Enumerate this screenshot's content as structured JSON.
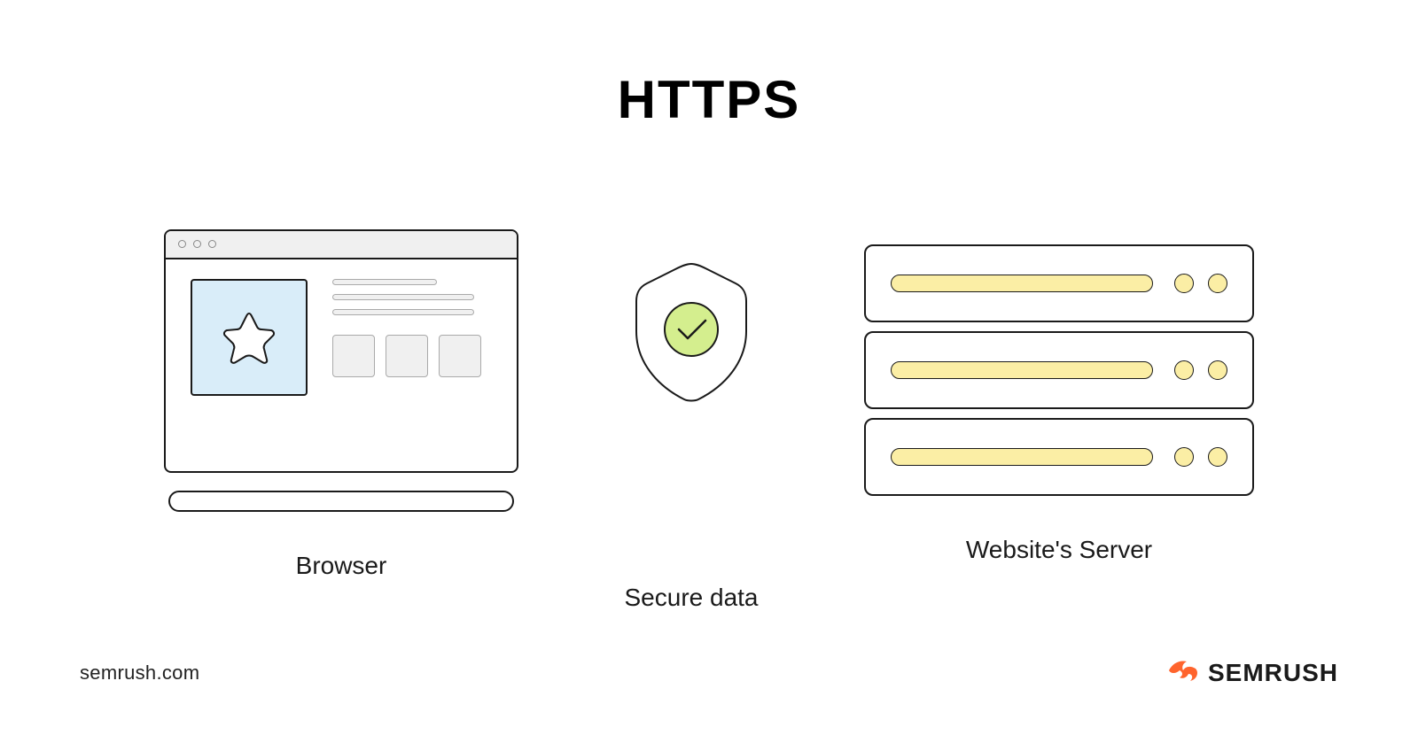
{
  "title": "HTTPS",
  "diagram": {
    "browser_label": "Browser",
    "secure_label": "Secure data",
    "server_label": "Website's Server"
  },
  "footer": {
    "url": "semrush.com",
    "brand": "SEMRUSH"
  },
  "colors": {
    "accent_orange": "#ff642d",
    "shield_check": "#d4ee8e",
    "browser_img_bg": "#d9edf9",
    "server_led": "#fbeea5"
  }
}
